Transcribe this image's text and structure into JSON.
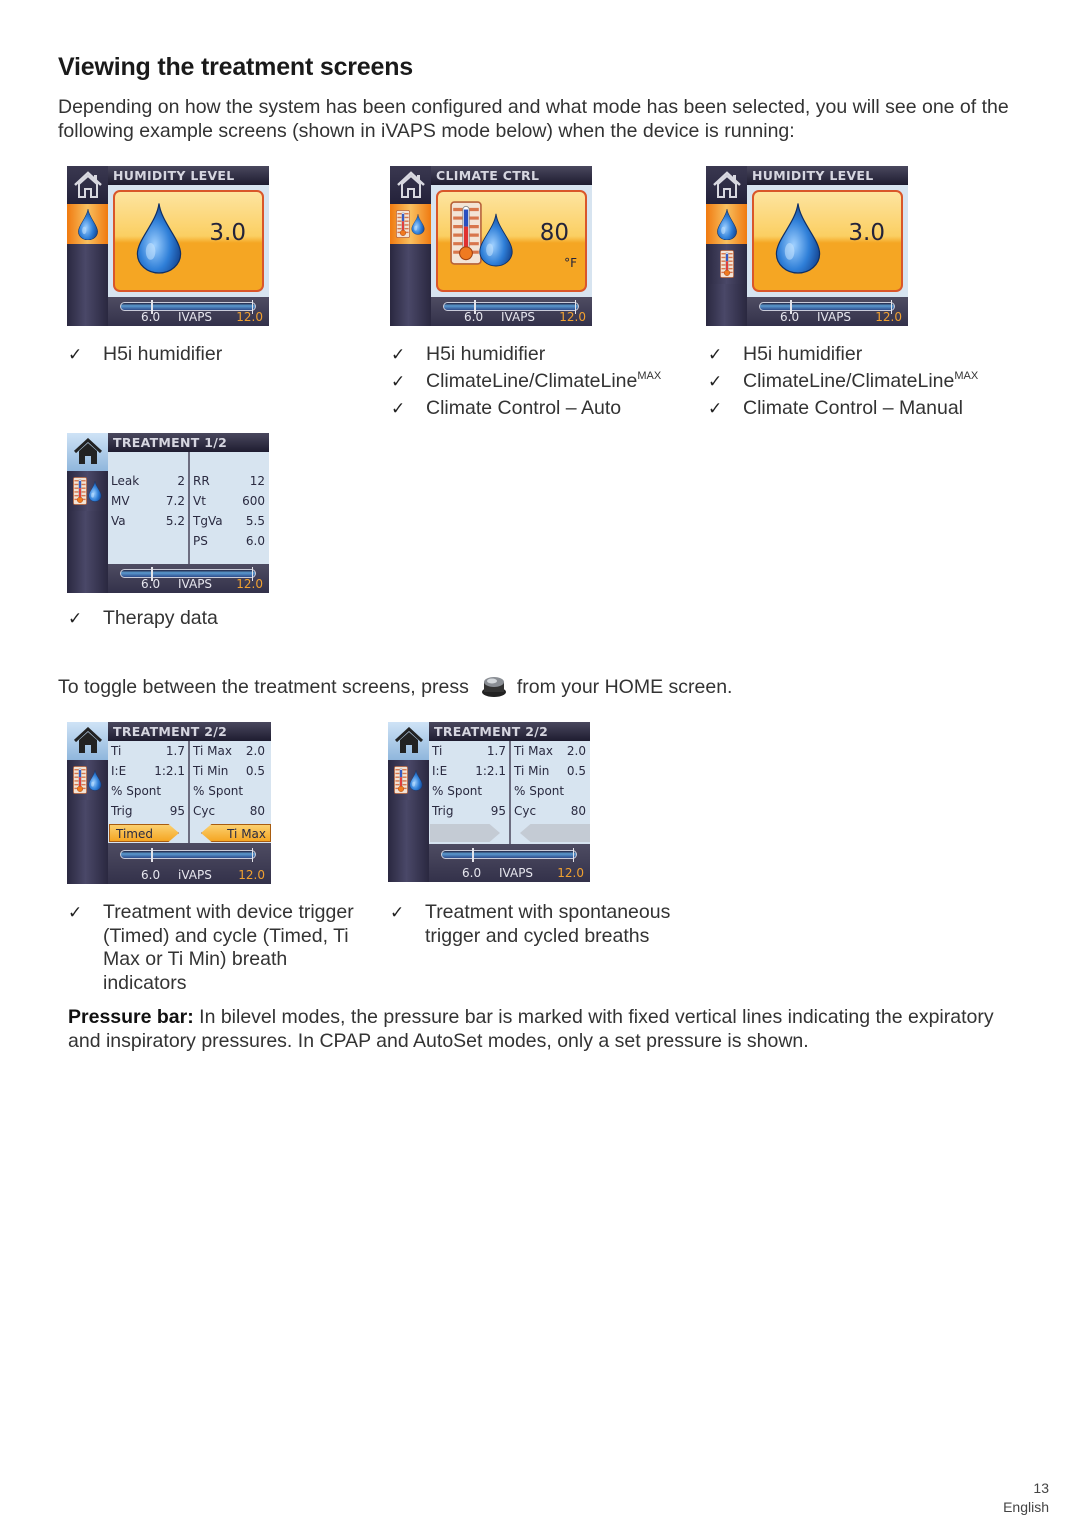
{
  "title": "Viewing the treatment screens",
  "intro": "Depending on how the system has been configured and what mode has been selected, you will see one of the following example screens (shown in iVAPS mode below) when the device is running:",
  "pressure_bar": {
    "low": "6.0",
    "mode": "IVAPS",
    "high": "12.0"
  },
  "pressure_bar_ivaps_lower": {
    "low": "6.0",
    "mode": "iVAPS",
    "high": "12.0"
  },
  "screens": {
    "humidity1": {
      "header": "HUMIDITY LEVEL",
      "value": "3.0"
    },
    "climate": {
      "header": "CLIMATE CTRL",
      "value": "80",
      "unit": "°F"
    },
    "humidity2": {
      "header": "HUMIDITY LEVEL",
      "value": "3.0"
    },
    "treatment1": {
      "header": "TREATMENT 1/2",
      "left": [
        {
          "k": "Leak",
          "v": "2"
        },
        {
          "k": "MV",
          "v": "7.2"
        },
        {
          "k": "Va",
          "v": "5.2"
        }
      ],
      "right": [
        {
          "k": "RR",
          "v": "12"
        },
        {
          "k": "Vt",
          "v": "600"
        },
        {
          "k": "TgVa",
          "v": "5.5"
        },
        {
          "k": "PS",
          "v": "6.0"
        }
      ]
    },
    "treatment2a": {
      "header": "TREATMENT 2/2",
      "left": [
        {
          "k": "Ti",
          "v": "1.7"
        },
        {
          "k": "I:E",
          "v": "1:2.1"
        },
        {
          "k": "% Spont",
          "v": ""
        },
        {
          "k": "Trig",
          "v": "95"
        }
      ],
      "right": [
        {
          "k": "Ti Max",
          "v": "2.0"
        },
        {
          "k": "Ti Min",
          "v": "0.5"
        },
        {
          "k": "% Spont",
          "v": ""
        },
        {
          "k": "Cyc",
          "v": "80"
        }
      ],
      "indicator_left": "Timed",
      "indicator_right": "Ti Max"
    },
    "treatment2b": {
      "header": "TREATMENT 2/2",
      "left": [
        {
          "k": "Ti",
          "v": "1.7"
        },
        {
          "k": "I:E",
          "v": "1:2.1"
        },
        {
          "k": "% Spont",
          "v": ""
        },
        {
          "k": "Trig",
          "v": "95"
        }
      ],
      "right": [
        {
          "k": "Ti Max",
          "v": "2.0"
        },
        {
          "k": "Ti Min",
          "v": "0.5"
        },
        {
          "k": "% Spont",
          "v": ""
        },
        {
          "k": "Cyc",
          "v": "80"
        }
      ]
    }
  },
  "captions": {
    "col1": [
      "H5i humidifier"
    ],
    "col2": [
      "H5i humidifier",
      "ClimateLine/ClimateLine",
      "Climate Control – Auto"
    ],
    "col3": [
      "H5i humidifier",
      "ClimateLine/ClimateLine",
      "Climate Control – Manual"
    ],
    "sup": "MAX",
    "therapy": "Therapy data",
    "timed": "Treatment with device trigger (Timed) and cycle (Timed, Ti Max or Ti Min) breath indicators",
    "spont": "Treatment with spontaneous trigger and cycled breaths"
  },
  "toggle": {
    "before": "To toggle between the treatment screens, press",
    "after": "from your HOME screen."
  },
  "note": {
    "label": "Pressure bar:",
    "text": " In bilevel modes, the pressure bar is marked with fixed vertical lines indicating the expiratory and inspiratory pressures. In CPAP and AutoSet modes, only a set pressure is shown."
  },
  "check_glyph": "✓",
  "page": {
    "number": "13",
    "language": "English"
  }
}
